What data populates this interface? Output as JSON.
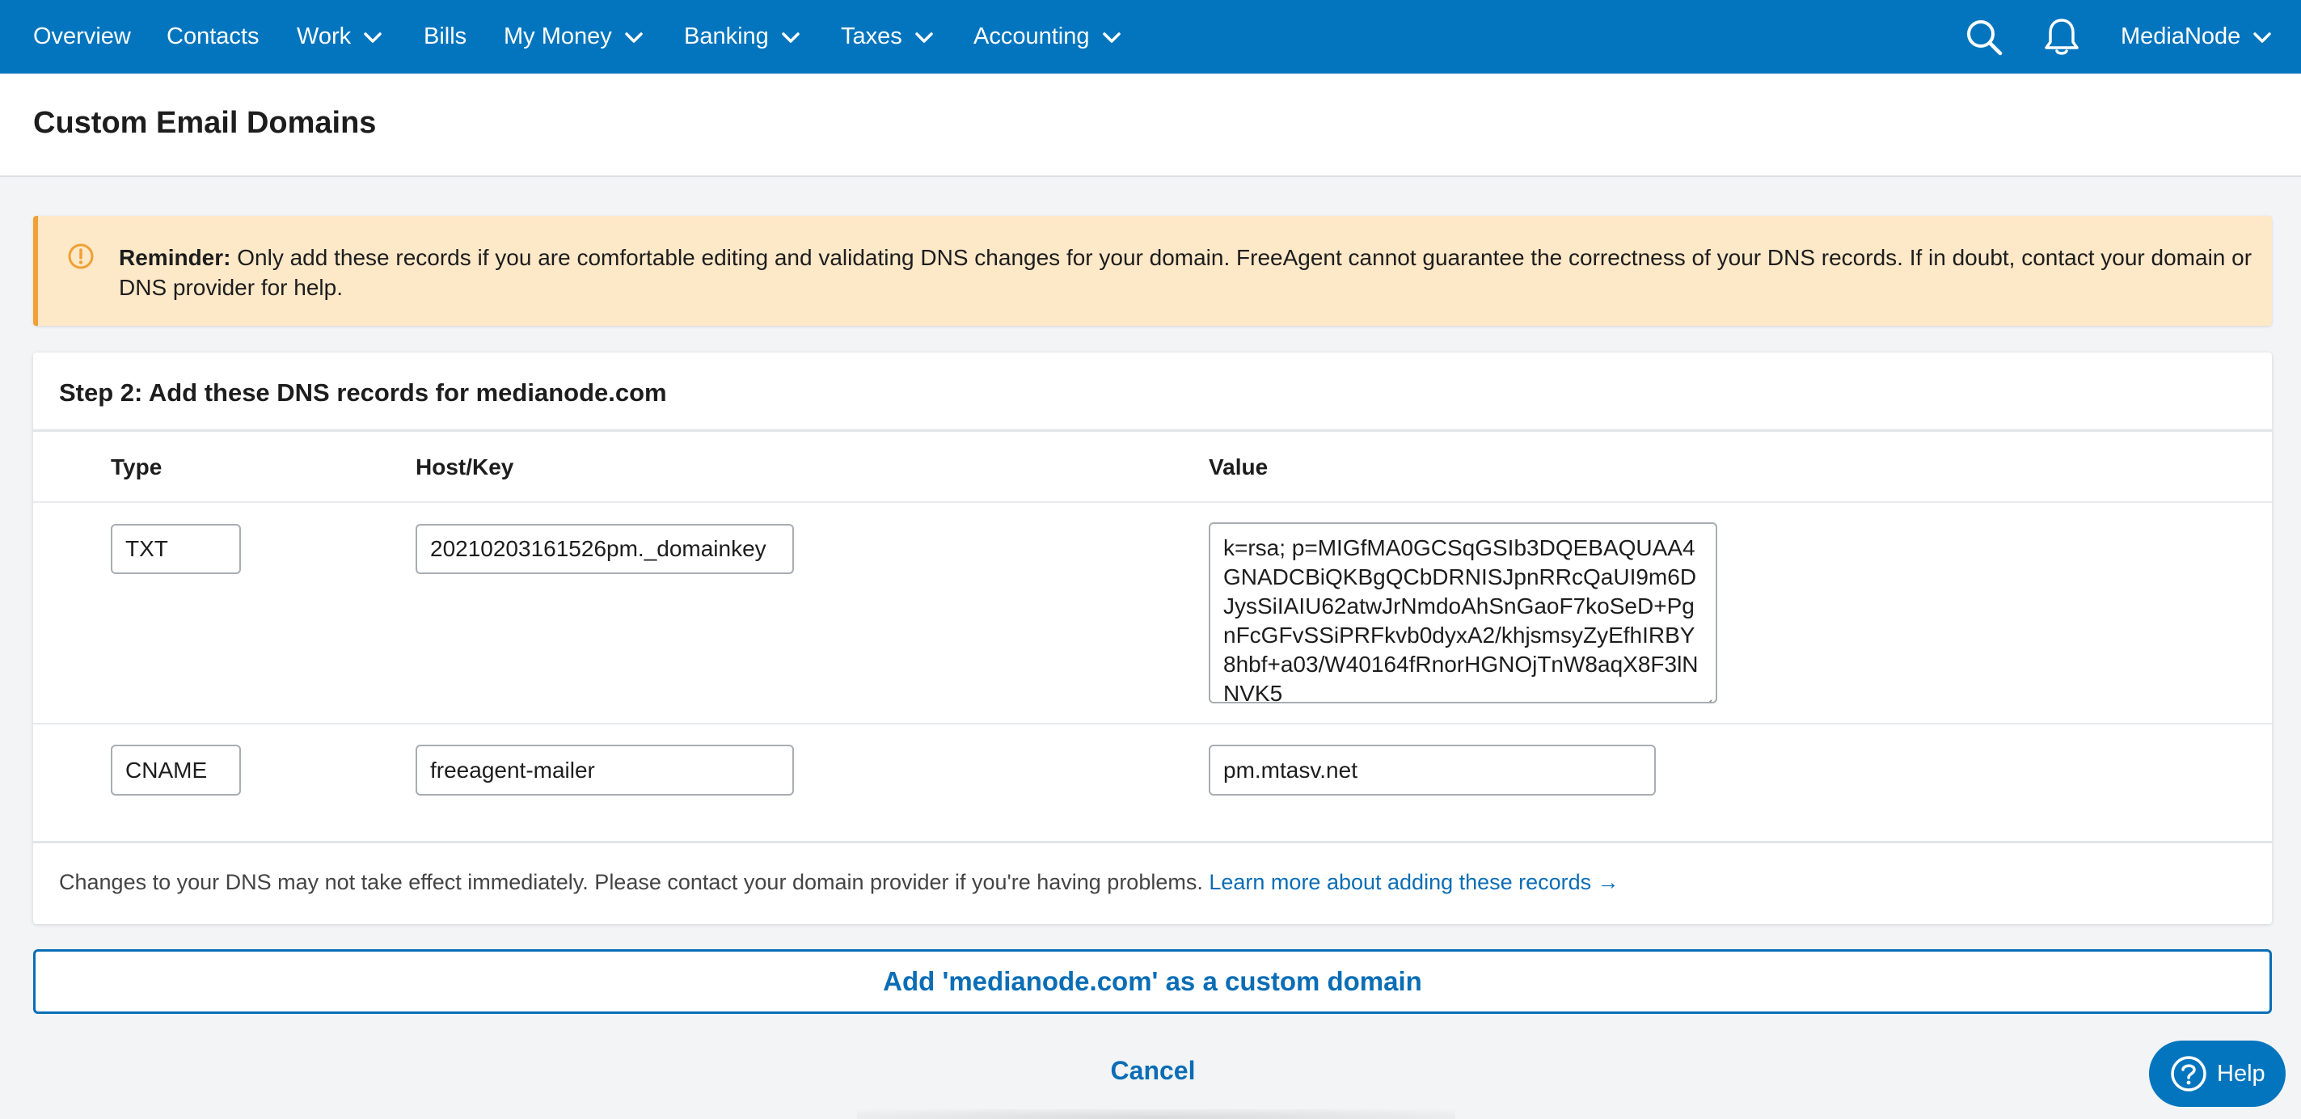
{
  "nav": {
    "items": [
      {
        "label": "Overview",
        "has_dropdown": false
      },
      {
        "label": "Contacts",
        "has_dropdown": false
      },
      {
        "label": "Work",
        "has_dropdown": true
      },
      {
        "label": "Bills",
        "has_dropdown": false
      },
      {
        "label": "My Money",
        "has_dropdown": true
      },
      {
        "label": "Banking",
        "has_dropdown": true
      },
      {
        "label": "Taxes",
        "has_dropdown": true
      },
      {
        "label": "Accounting",
        "has_dropdown": true
      }
    ],
    "search_icon": "search-icon",
    "notifications_icon": "bell-icon",
    "account_label": "MediaNode",
    "color": "#0275be"
  },
  "page": {
    "title": "Custom Email Domains"
  },
  "reminder": {
    "icon": "warning-circle-icon",
    "bold_label": "Reminder:",
    "text": "Only add these records if you are comfortable editing and validating DNS changes for your domain. FreeAgent cannot guarantee the correctness of your DNS records. If in doubt, contact your domain or DNS provider for help.",
    "background": "#fde8c8",
    "accent": "#f0a034"
  },
  "card": {
    "title": "Step 2: Add these DNS records for medianode.com",
    "columns": {
      "type": "Type",
      "host": "Host/Key",
      "value": "Value"
    },
    "records": [
      {
        "type": "TXT",
        "host": "20210203161526pm._domainkey",
        "value": "k=rsa; p=MIGfMA0GCSqGSIb3DQEBAQUAA4GNADCBiQKBgQCbDRNISJpnRRcQaUI9m6DJysSiIAIU62atwJrNmdoAhSnGaoF7koSeD+PgnFcGFvSSiPRFkvb0dyxA2/khjsmsyZyEfhIRBY8hbf+a03/W40164fRnorHGNOjTnW8aqX8F3lNNVK5"
      },
      {
        "type": "CNAME",
        "host": "freeagent-mailer",
        "value": "pm.mtasv.net"
      }
    ],
    "footer_text": "Changes to your DNS may not take effect immediately. Please contact your domain provider if you're having problems.",
    "footer_link": "Learn more about adding these records →"
  },
  "actions": {
    "add_domain": "Add 'medianode.com' as a custom domain",
    "cancel": "Cancel",
    "help": "Help",
    "accent": "#0a6db5"
  }
}
